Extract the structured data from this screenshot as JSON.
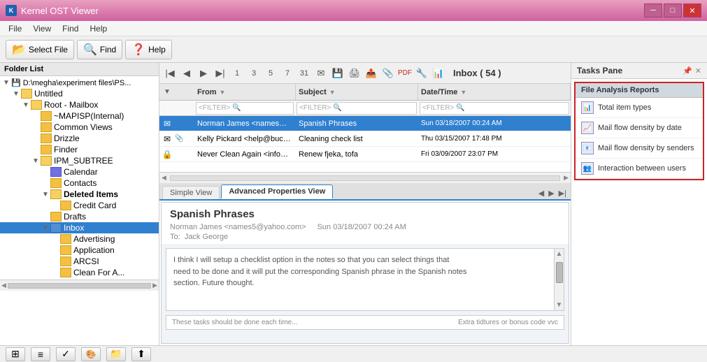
{
  "app": {
    "title": "Kernel OST Viewer",
    "icon": "K"
  },
  "titlebar": {
    "minimize": "─",
    "maximize": "□",
    "close": "✕"
  },
  "menubar": {
    "items": [
      "File",
      "View",
      "Find",
      "Help"
    ]
  },
  "toolbar": {
    "select_file_label": "Select File",
    "find_label": "Find",
    "help_label": "Help"
  },
  "folder_panel": {
    "header": "Folder List",
    "path": "D:\\megha\\experiment files\\PS...",
    "untitled": "Untitled",
    "root_mailbox": "Root - Mailbox",
    "mapi_internal": "~MAPISP(Internal)",
    "common_views": "Common Views",
    "drizzle": "Drizzle",
    "finder": "Finder",
    "ipm_subtree": "IPM_SUBTREE",
    "calendar": "Calendar",
    "contacts": "Contacts",
    "deleted_items": "Deleted Items",
    "credit_card": "Credit Card",
    "drafts": "Drafts",
    "inbox": "Inbox",
    "advertising": "Advertising",
    "application": "Application",
    "arcsi": "ARCSI",
    "clean_for": "Clean For A..."
  },
  "email_list": {
    "inbox_label": "Inbox ( 54 )",
    "columns": {
      "from": "From",
      "subject": "Subject",
      "datetime": "Date/Time"
    },
    "filters": {
      "from": "<FILTER>",
      "subject": "<FILTER>",
      "datetime": "<FILTER>"
    },
    "emails": [
      {
        "from": "Norman James <names@b...",
        "subject": "Spanish Phrases",
        "datetime": "Sun 03/18/2007 00:24 AM"
      },
      {
        "from": "Kelly Pickard <help@buck...",
        "subject": "Cleaning check list",
        "datetime": "Thu 03/15/2007 17:48 PM"
      },
      {
        "from": "Never Clean Again <info@n...",
        "subject": "Renew fjeka, tofa",
        "datetime": "Fri 03/09/2007 23:07 PM"
      }
    ]
  },
  "tabs": {
    "simple_view": "Simple View",
    "advanced_properties_view": "Advanced Properties View"
  },
  "preview": {
    "subject": "Spanish Phrases",
    "from_label": "Norman James <names5@yahoo.com>",
    "datetime": "Sun 03/18/2007 00:24 AM",
    "to_label": "To:",
    "to_name": "Jack George",
    "body_line1": "I think I will setup a checklist option in the notes so that you can select things that",
    "body_line2": "need to be done and it will put the corresponding Spanish phrase in the Spanish notes",
    "body_line3": "section. Future thought.",
    "footer_left": "These tasks should be done each time...",
    "footer_right": "Extra tidtures or bonus code vvc"
  },
  "tasks_pane": {
    "header": "Tasks Pane",
    "pin": "📌",
    "close": "✕",
    "section": "File Analysis Reports",
    "items": [
      {
        "label": "Total item types",
        "icon": "📊"
      },
      {
        "label": "Mail flow density by date",
        "icon": "📈"
      },
      {
        "label": "Mail flow density by senders",
        "icon": "📧"
      },
      {
        "label": "Interaction between users",
        "icon": "👥"
      }
    ]
  },
  "statusbar": {
    "buttons": [
      "⊞",
      "≡",
      "✓",
      "🎨",
      "📁",
      "⬆"
    ]
  }
}
